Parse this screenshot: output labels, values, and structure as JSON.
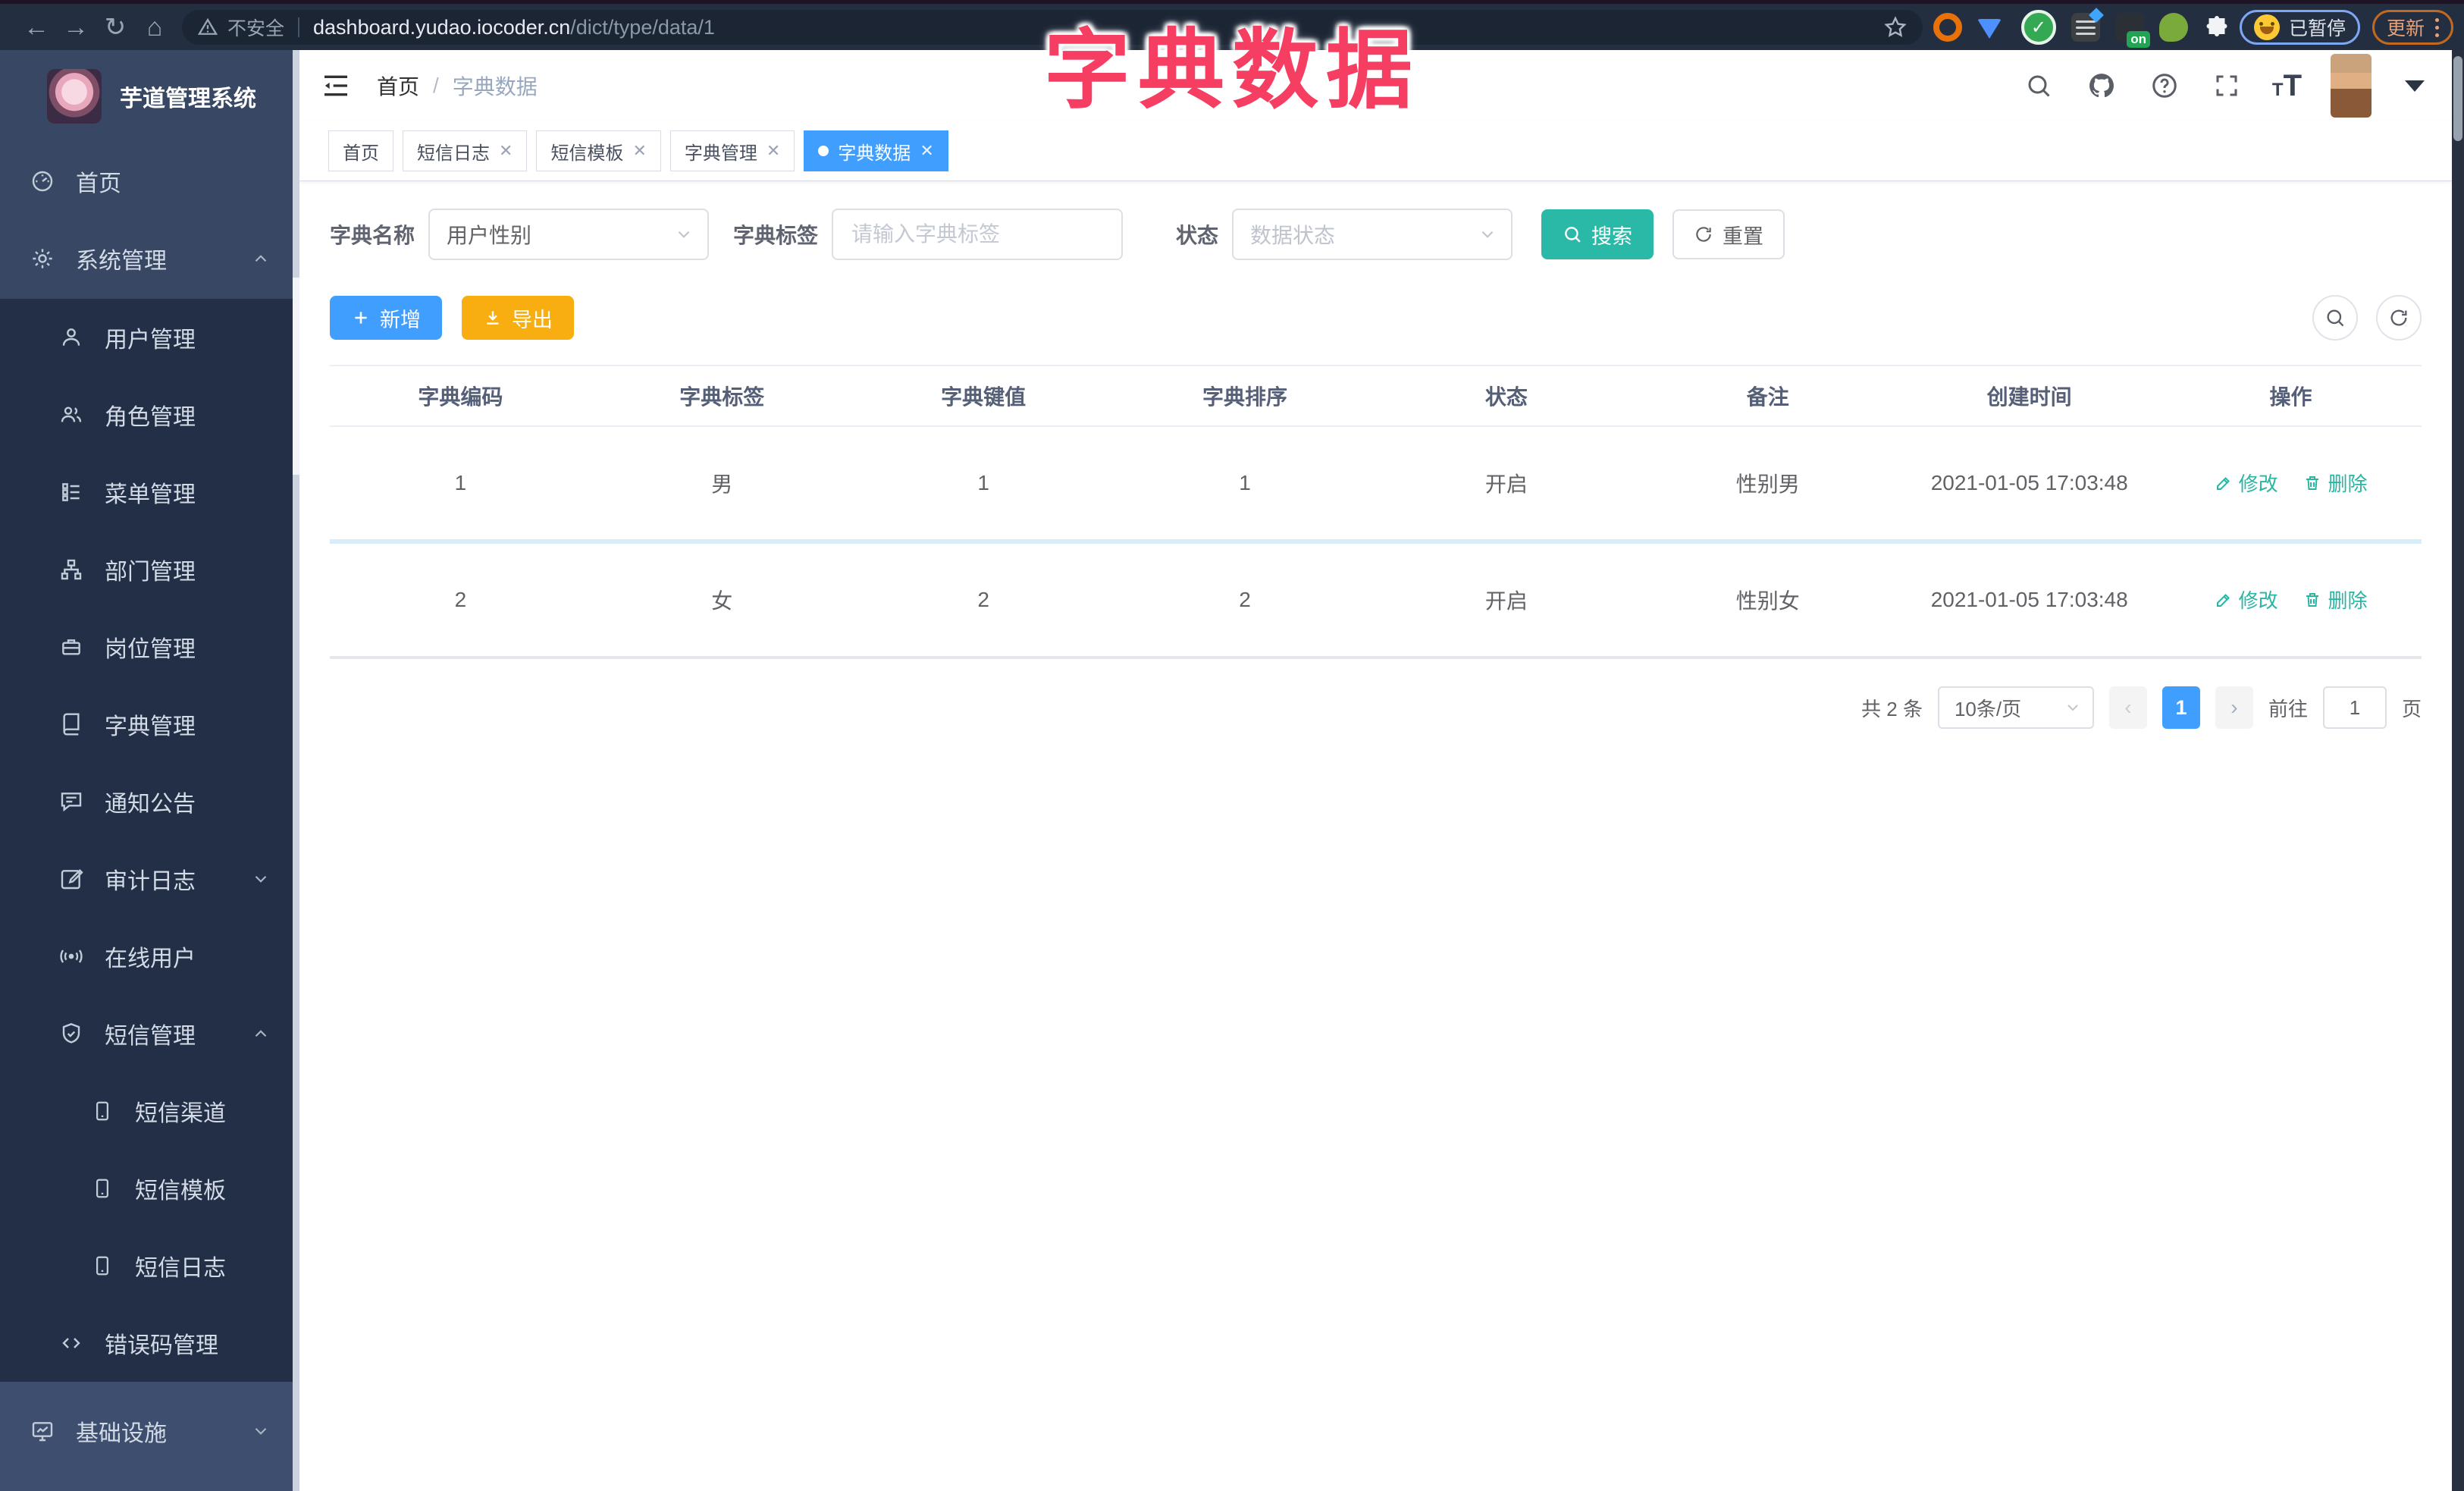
{
  "overlay_title": "字典数据",
  "browser": {
    "security_label": "不安全",
    "url_host": "dashboard.yudao.iocoder.cn",
    "url_path": "/dict/type/data/1",
    "ext_on_badge": "on",
    "profile_status": "已暂停",
    "update_label": "更新"
  },
  "sidebar": {
    "app_title": "芋道管理系统",
    "items": [
      {
        "label": "首页"
      },
      {
        "label": "系统管理"
      },
      {
        "label": "用户管理"
      },
      {
        "label": "角色管理"
      },
      {
        "label": "菜单管理"
      },
      {
        "label": "部门管理"
      },
      {
        "label": "岗位管理"
      },
      {
        "label": "字典管理"
      },
      {
        "label": "通知公告"
      },
      {
        "label": "审计日志"
      },
      {
        "label": "在线用户"
      },
      {
        "label": "短信管理"
      },
      {
        "label": "短信渠道"
      },
      {
        "label": "短信模板"
      },
      {
        "label": "短信日志"
      },
      {
        "label": "错误码管理"
      },
      {
        "label": "基础设施"
      }
    ]
  },
  "header": {
    "breadcrumb_home": "首页",
    "breadcrumb_sep": "/",
    "breadcrumb_current": "字典数据"
  },
  "tabs": [
    {
      "label": "首页"
    },
    {
      "label": "短信日志"
    },
    {
      "label": "短信模板"
    },
    {
      "label": "字典管理"
    },
    {
      "label": "字典数据"
    }
  ],
  "filters": {
    "name_label": "字典名称",
    "name_value": "用户性别",
    "tag_label": "字典标签",
    "tag_placeholder": "请输入字典标签",
    "status_label": "状态",
    "status_placeholder": "数据状态",
    "search_label": "搜索",
    "reset_label": "重置"
  },
  "toolbar": {
    "add_label": "新增",
    "export_label": "导出"
  },
  "table": {
    "columns": [
      "字典编码",
      "字典标签",
      "字典键值",
      "字典排序",
      "状态",
      "备注",
      "创建时间",
      "操作"
    ],
    "rows": [
      {
        "code": "1",
        "label": "男",
        "value": "1",
        "sort": "1",
        "status": "开启",
        "remark": "性别男",
        "created": "2021-01-05 17:03:48",
        "edit": "修改",
        "delete": "删除"
      },
      {
        "code": "2",
        "label": "女",
        "value": "2",
        "sort": "2",
        "status": "开启",
        "remark": "性别女",
        "created": "2021-01-05 17:03:48",
        "edit": "修改",
        "delete": "删除"
      }
    ]
  },
  "pagination": {
    "total": "共 2 条",
    "size": "10条/页",
    "page": "1",
    "goto": "前往",
    "unit": "页"
  },
  "colors": {
    "accent": "#409EFF",
    "teal": "#2BB9A7",
    "warning": "#F8AE10",
    "pink": "#F53E62"
  }
}
